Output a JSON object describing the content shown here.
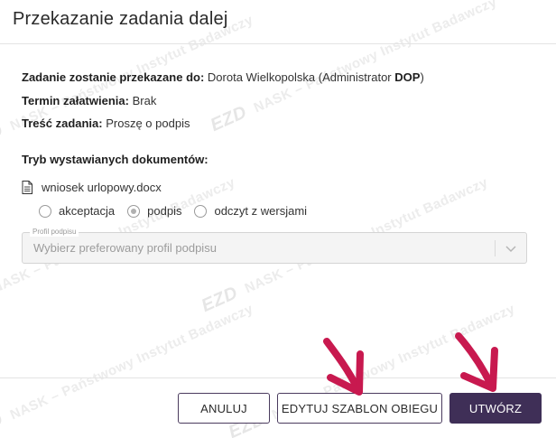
{
  "dialog": {
    "title": "Przekazanie zadania dalej"
  },
  "details": {
    "recipient_label": "Zadanie zostanie przekazane do:",
    "recipient_name": "Dorota Wielkopolska (Administrator ",
    "recipient_role": "DOP",
    "recipient_close": ")",
    "deadline_label": "Termin załatwienia:",
    "deadline_value": "Brak",
    "content_label": "Treść zadania:",
    "content_value": "Proszę o podpis",
    "mode_label": "Tryb wystawianych dokumentów:"
  },
  "document": {
    "icon": "document-icon",
    "filename": "wniosek urlopowy.docx",
    "options": [
      {
        "label": "akceptacja",
        "checked": false
      },
      {
        "label": "podpis",
        "checked": true
      },
      {
        "label": "odczyt z wersjami",
        "checked": false
      }
    ]
  },
  "signature_profile": {
    "legend": "Profil podpisu",
    "placeholder": "Wybierz preferowany profil podpisu",
    "disabled": true
  },
  "buttons": {
    "cancel": "ANULUJ",
    "edit_template": "EDYTUJ SZABLON OBIEGU",
    "create": "UTWÓRZ"
  },
  "watermark": {
    "logo": "EZD",
    "text": "NASK – Państwowy Instytut Badawczy"
  },
  "colors": {
    "primary": "#3f2f57",
    "annotation_arrow": "#c8194f"
  }
}
